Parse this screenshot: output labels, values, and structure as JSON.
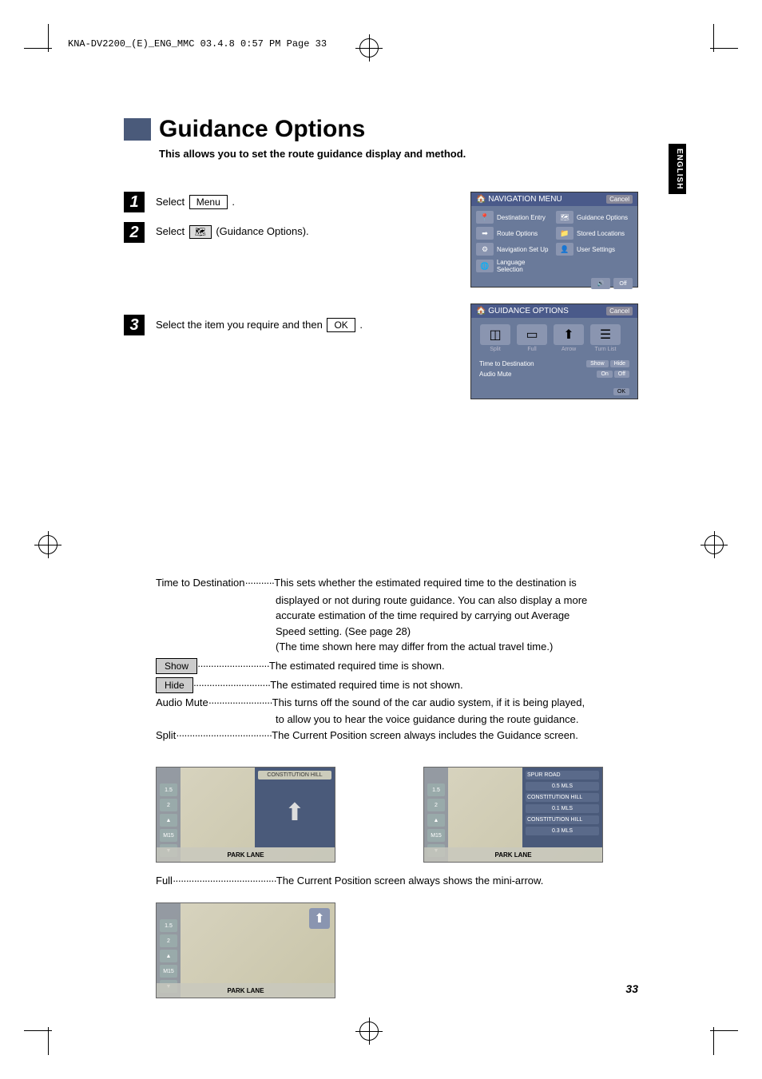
{
  "header": "KNA-DV2200_(E)_ENG_MMC  03.4.8  0:57 PM  Page 33",
  "side_tab": "ENGLISH",
  "title": "Guidance Options",
  "subtitle": "This allows you to set the route guidance display and method.",
  "steps": {
    "s1_pre": "Select ",
    "s1_btn": "Menu",
    "s1_post": " .",
    "s2_pre": "Select ",
    "s2_post": " (Guidance Options).",
    "s3_pre": "Select the item you require and then ",
    "s3_btn": "OK",
    "s3_post": " ."
  },
  "nav_menu": {
    "title": "NAVIGATION MENU",
    "cancel": "Cancel",
    "items": [
      "Destination Entry",
      "Guidance Options",
      "Route Options",
      "Stored Locations",
      "Navigation Set Up",
      "User Settings",
      "Language Selection"
    ]
  },
  "guidance_panel": {
    "title": "GUIDANCE OPTIONS",
    "cancel": "Cancel",
    "icons": [
      "Split",
      "Full",
      "Arrow",
      "Turn List"
    ],
    "row1_label": "Time to Destination",
    "row1_opts": [
      "Show",
      "Hide"
    ],
    "row2_label": "Audio Mute",
    "row2_opts": [
      "On",
      "Off"
    ],
    "ok": "OK"
  },
  "descriptions": {
    "ttd_label": "Time to Destination",
    "ttd_text1": "This sets whether the estimated required time to the destination is",
    "ttd_text2": "displayed or not during route guidance. You can also display a more",
    "ttd_text3": "accurate estimation of the time required by carrying out Average",
    "ttd_text4": "Speed setting. (See page 28)",
    "ttd_text5": "(The time shown here may differ from the actual travel time.)",
    "show_label": "Show",
    "show_text": "The estimated required time is shown.",
    "hide_label": "Hide",
    "hide_text": "The estimated required time is not shown.",
    "mute_label": "Audio Mute",
    "mute_text1": "This turns off the sound of the car audio system, if it is being played,",
    "mute_text2": "to allow you to hear the voice guidance during the route guidance.",
    "split_label": "Split",
    "split_text": "The Current Position screen always includes the Guidance screen.",
    "full_label": "Full",
    "full_text": "The Current Position screen always shows the mini-arrow."
  },
  "map": {
    "road": "PARK LANE",
    "dest1": "CONSTITUTION HILL",
    "scale1": "1.5",
    "scale2": "2",
    "mway": "M15",
    "turns": [
      {
        "name": "SPUR ROAD",
        "dist": "0.5 MLS"
      },
      {
        "name": "CONSTITUTION HILL",
        "dist": "0.1 MLS"
      },
      {
        "name": "CONSTITUTION HILL",
        "dist": "0.3 MLS"
      }
    ]
  },
  "page_number": "33"
}
